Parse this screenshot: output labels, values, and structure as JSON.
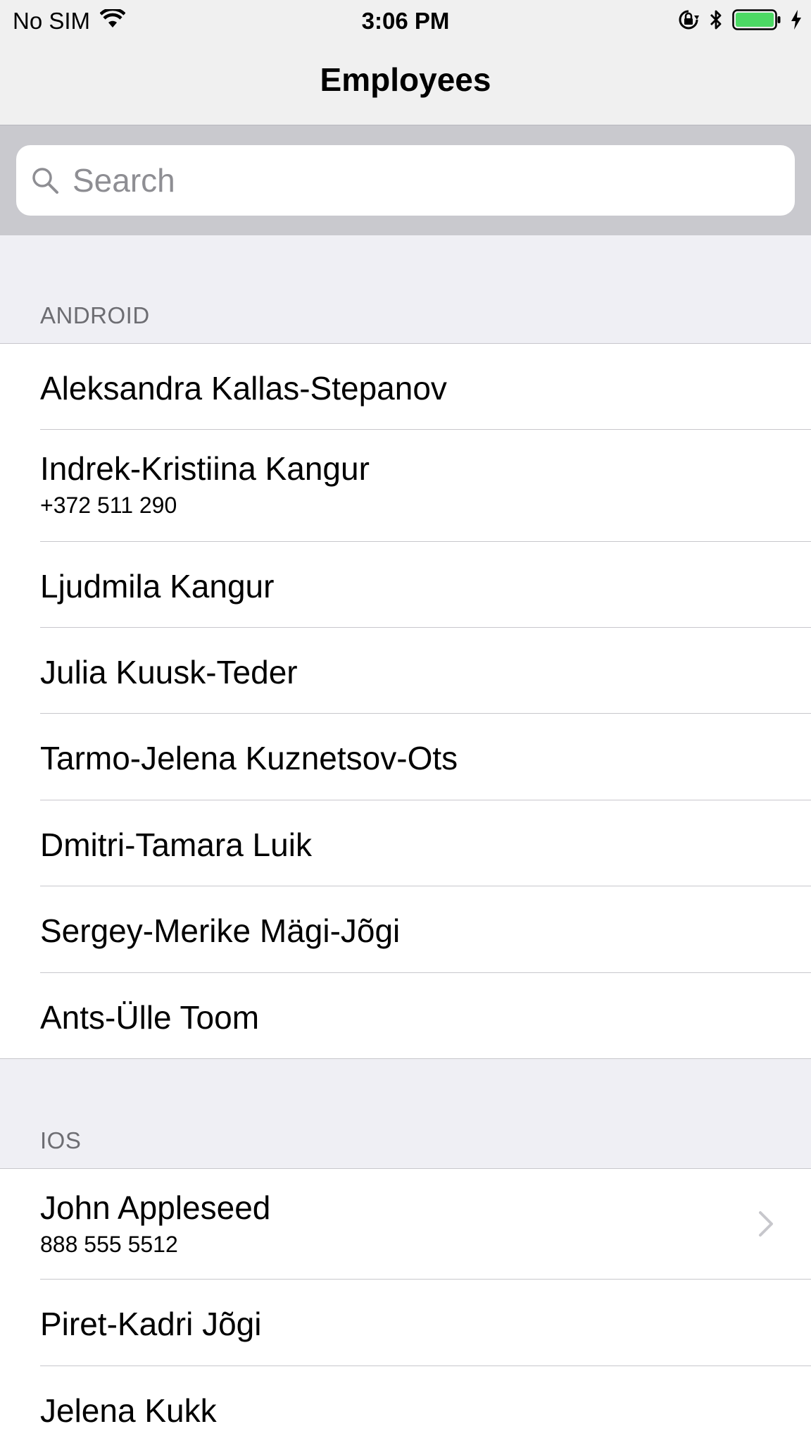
{
  "status_bar": {
    "carrier": "No SIM",
    "time": "3:06 PM",
    "icons": [
      "wifi-icon",
      "orientation-lock-icon",
      "bluetooth-icon",
      "battery-icon",
      "charging-icon"
    ],
    "battery_color": "#4cd964"
  },
  "navbar": {
    "title": "Employees"
  },
  "search": {
    "placeholder": "Search",
    "value": ""
  },
  "sections": [
    {
      "header": "ANDROID",
      "rows": [
        {
          "name": "Aleksandra Kallas-Stepanov"
        },
        {
          "name": "Indrek-Kristiina Kangur",
          "phone": "+372 511 290"
        },
        {
          "name": "Ljudmila Kangur"
        },
        {
          "name": "Julia Kuusk-Teder"
        },
        {
          "name": "Tarmo-Jelena Kuznetsov-Ots"
        },
        {
          "name": "Dmitri-Tamara Luik"
        },
        {
          "name": "Sergey-Merike Mägi-Jõgi"
        },
        {
          "name": "Ants-Ülle Toom"
        }
      ]
    },
    {
      "header": "IOS",
      "rows": [
        {
          "name": "John Appleseed",
          "phone": "888 555 5512",
          "disclosure": "chevron-right-icon"
        },
        {
          "name": "Piret-Kadri Jõgi"
        },
        {
          "name": "Jelena Kukk"
        }
      ]
    }
  ]
}
